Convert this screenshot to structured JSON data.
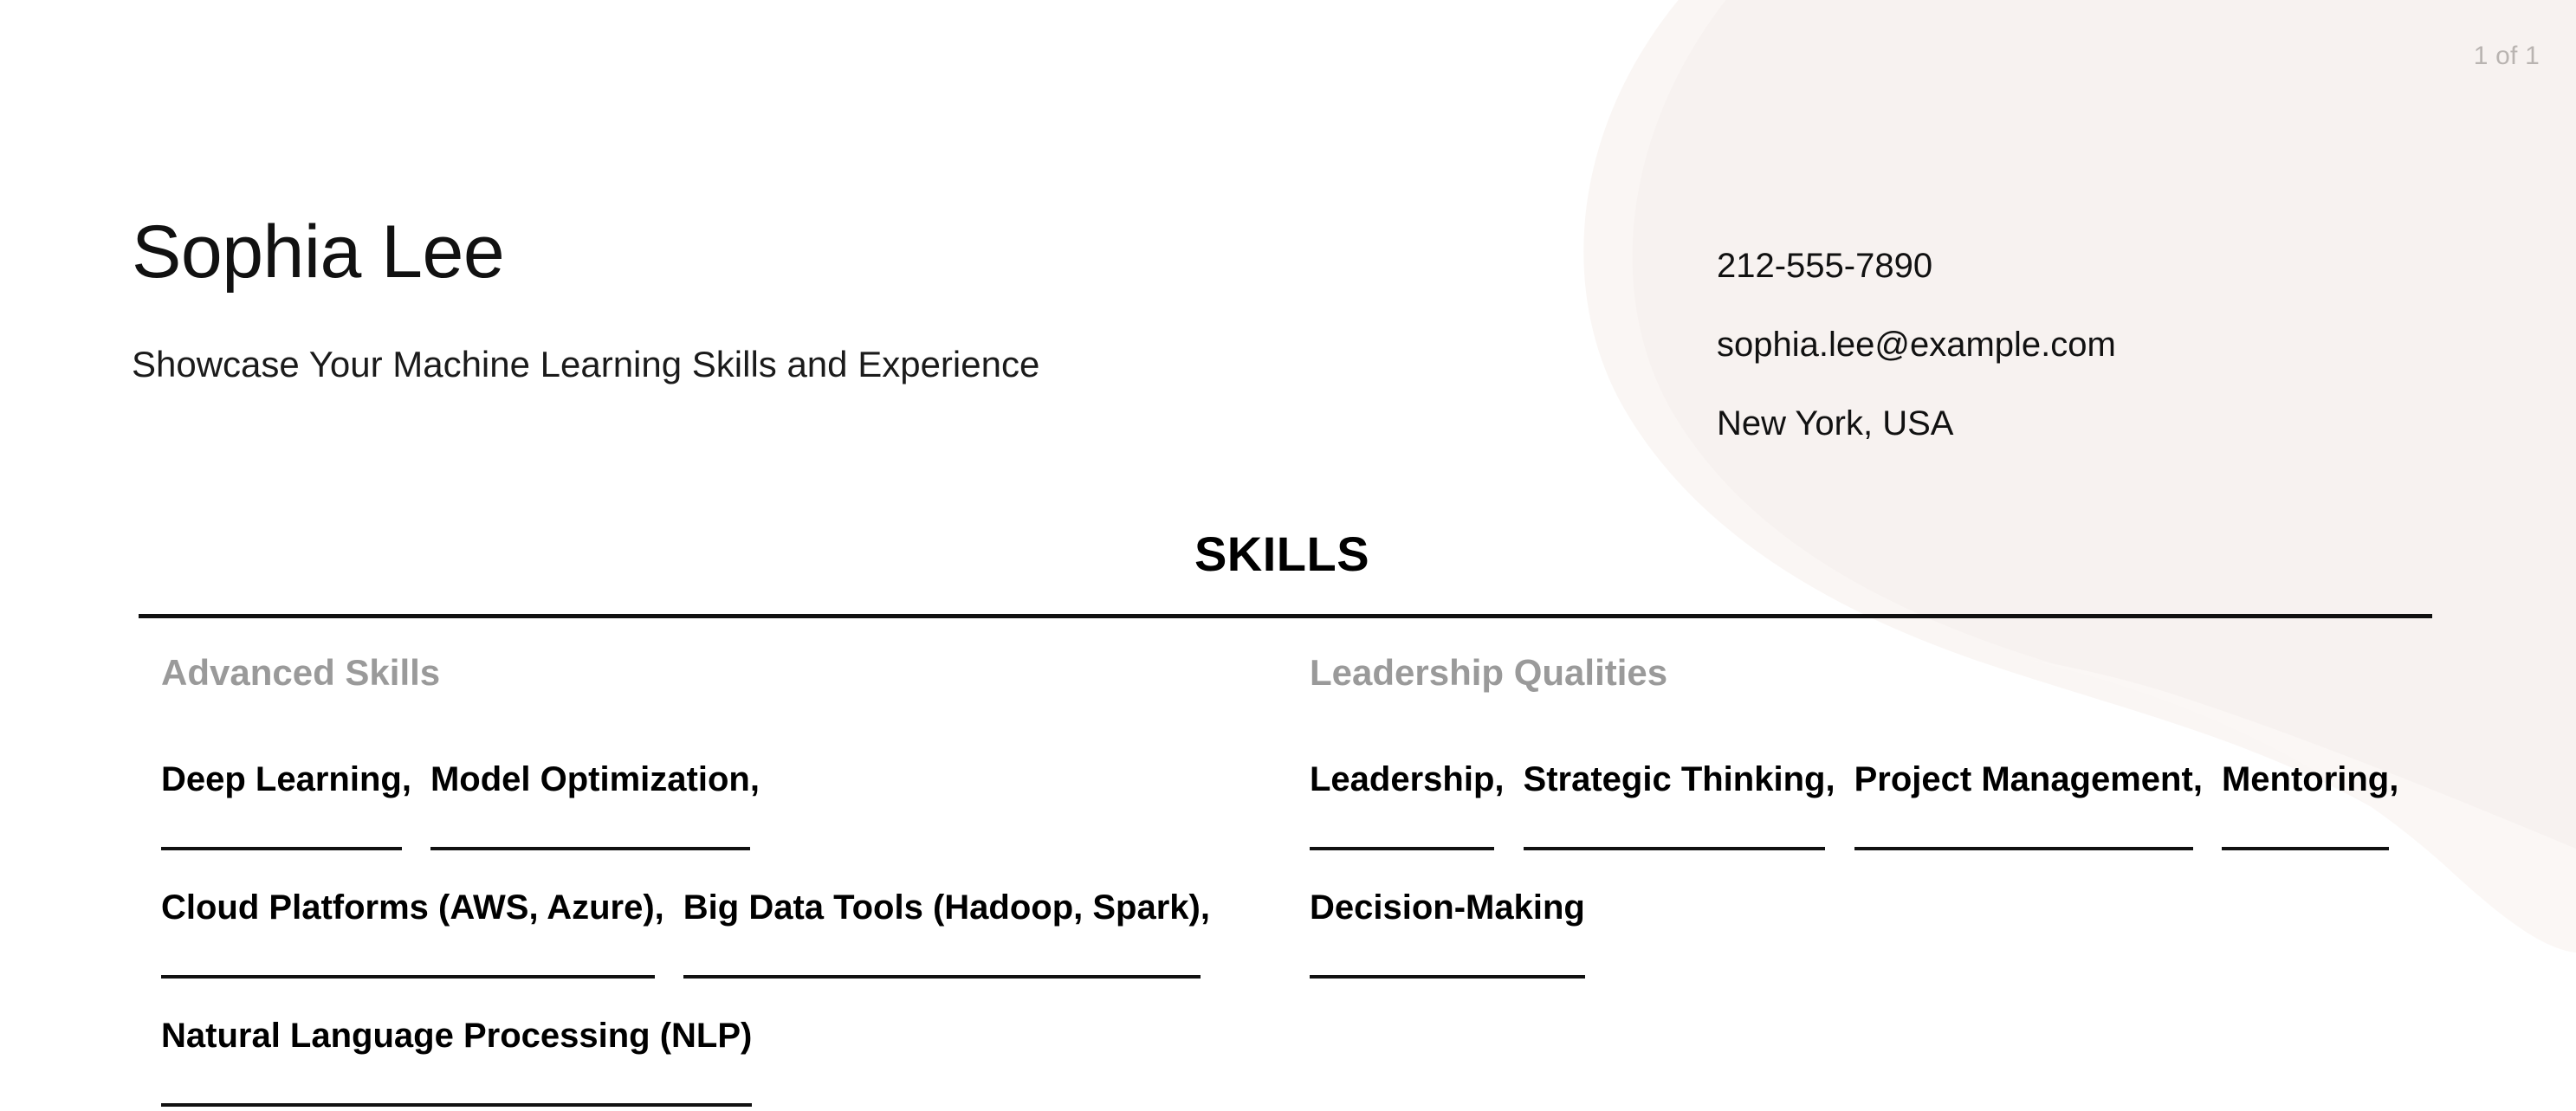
{
  "page": {
    "indicator": "1 of 1",
    "background_color": "#ffffff",
    "decor_color": "#f7f2f0",
    "decor_color_secondary": "#faf6f4"
  },
  "header": {
    "name": "Sophia Lee",
    "tagline": "Showcase Your Machine Learning Skills and Experience",
    "contact": {
      "phone": "212-555-7890",
      "email": "sophia.lee@example.com",
      "location": "New York, USA"
    }
  },
  "section": {
    "title": "SKILLS",
    "rule_color": "#111111",
    "subtitle_color": "#9a9a9a",
    "columns": [
      {
        "subtitle": "Advanced Skills",
        "items": [
          {
            "name": "Deep Learning",
            "sep": ","
          },
          {
            "name": "Model Optimization",
            "sep": ","
          },
          {
            "name": "Cloud Platforms (AWS, Azure)",
            "sep": ","
          },
          {
            "name": "Big Data Tools (Hadoop, Spark)",
            "sep": ","
          },
          {
            "name": "Natural Language Processing (NLP)",
            "sep": ""
          }
        ]
      },
      {
        "subtitle": "Leadership Qualities",
        "items": [
          {
            "name": "Leadership",
            "sep": ","
          },
          {
            "name": "Strategic Thinking",
            "sep": ","
          },
          {
            "name": "Project Management",
            "sep": ","
          },
          {
            "name": "Mentoring",
            "sep": ","
          },
          {
            "name": "Decision-Making",
            "sep": ""
          }
        ]
      }
    ]
  }
}
